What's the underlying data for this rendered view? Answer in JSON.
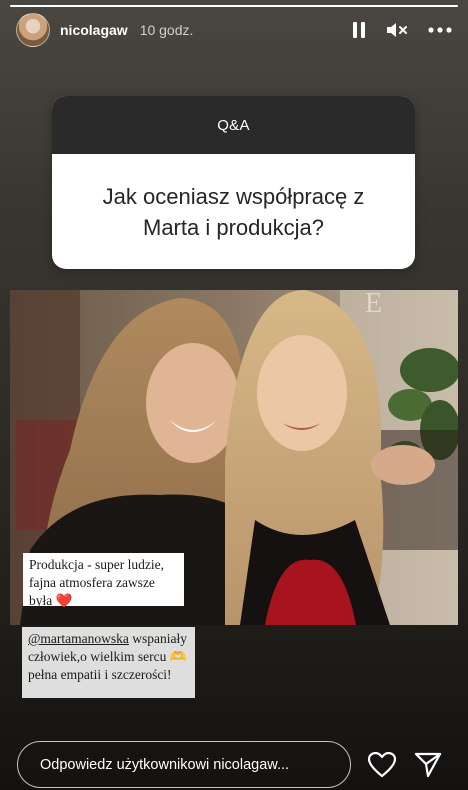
{
  "story": {
    "progress": 1.0,
    "username": "nicolagaw",
    "time": "10 godz."
  },
  "icons": {
    "pause": "pause-icon",
    "mute": "volume-off-icon",
    "more": "more-icon",
    "heart": "heart-icon",
    "send": "send-icon"
  },
  "qa": {
    "header": "Q&A",
    "question": "Jak oceniasz współpracę z Marta i produkcja?"
  },
  "captions": {
    "first": "Produkcja - super ludzie, fajna atmosfera zawsze była ❤️",
    "second_mention": "@martamanowska",
    "second_rest": " wspaniały człowiek,o wielkim sercu 🫶 pełna empatii i szczerości!"
  },
  "reply": {
    "placeholder": "Odpowiedz użytkownikowi nicolagaw..."
  },
  "colors": {
    "qa_header_bg": "#2a2a2a",
    "qa_body_bg": "#ffffff",
    "text_dark": "#262626"
  }
}
